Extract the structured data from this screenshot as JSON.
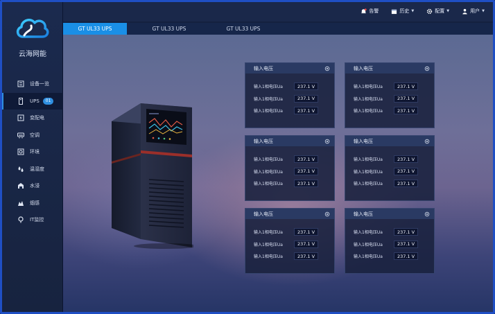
{
  "brand": {
    "name": "云海网能"
  },
  "sidebar": {
    "items": [
      {
        "label": "设备一览",
        "icon": "list-icon"
      },
      {
        "label": "UPS",
        "icon": "ups-icon",
        "badge": "01"
      },
      {
        "label": "变配电",
        "icon": "power-icon"
      },
      {
        "label": "空调",
        "icon": "air-conditioner-icon"
      },
      {
        "label": "环境",
        "icon": "environment-icon"
      },
      {
        "label": "温湿度",
        "icon": "humidity-icon"
      },
      {
        "label": "水浸",
        "icon": "water-icon"
      },
      {
        "label": "烟感",
        "icon": "smoke-icon"
      },
      {
        "label": "IT监控",
        "icon": "monitor-icon"
      }
    ]
  },
  "topbar": {
    "alarm": "告警",
    "history": "历史",
    "config": "配置",
    "user": "用户"
  },
  "tabs": [
    "GT UL33 UPS",
    "GT UL33 UPS",
    "GT UL33 UPS"
  ],
  "panels": [
    {
      "title": "输入电压",
      "rows": [
        {
          "label": "输入1相电压Ua",
          "value": "237.1 V"
        },
        {
          "label": "输入1相电压Ua",
          "value": "237.1 V"
        },
        {
          "label": "输入1相电压Ua",
          "value": "237.1 V"
        }
      ]
    },
    {
      "title": "输入电压",
      "rows": [
        {
          "label": "输入1相电压Ua",
          "value": "237.1 V"
        },
        {
          "label": "输入1相电压Ua",
          "value": "237.1 V"
        },
        {
          "label": "输入1相电压Ua",
          "value": "237.1 V"
        }
      ]
    },
    {
      "title": "输入电压",
      "rows": [
        {
          "label": "输入1相电压Ua",
          "value": "237.1 V"
        },
        {
          "label": "输入1相电压Ua",
          "value": "237.1 V"
        },
        {
          "label": "输入1相电压Ua",
          "value": "237.1 V"
        }
      ]
    },
    {
      "title": "输入电压",
      "rows": [
        {
          "label": "输入1相电压Ua",
          "value": "237.1 V"
        },
        {
          "label": "输入1相电压Ua",
          "value": "237.1 V"
        },
        {
          "label": "输入1相电压Ua",
          "value": "237.1 V"
        }
      ]
    },
    {
      "title": "输入电压",
      "rows": [
        {
          "label": "输入1相电压Ua",
          "value": "237.1 V"
        },
        {
          "label": "输入1相电压Ua",
          "value": "237.1 V"
        },
        {
          "label": "输入1相电压Ua",
          "value": "237.1 V"
        }
      ]
    },
    {
      "title": "输入电压",
      "rows": [
        {
          "label": "输入1相电压Ua",
          "value": "237.1 V"
        },
        {
          "label": "输入1相电压Ua",
          "value": "237.1 V"
        },
        {
          "label": "输入1相电压Ua",
          "value": "237.1 V"
        }
      ]
    }
  ],
  "colors": {
    "accent": "#1a8fe6",
    "frame": "#1f4fc4",
    "sidebar": "#1b2a4e",
    "panel": "#19213e"
  }
}
